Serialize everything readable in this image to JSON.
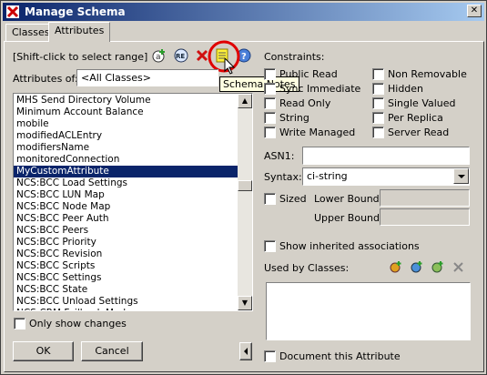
{
  "window": {
    "title": "Manage Schema",
    "close_glyph": "✕"
  },
  "tabs": [
    {
      "label": "Classes"
    },
    {
      "label": "Attributes"
    }
  ],
  "left": {
    "hint": "[Shift-click to select range]",
    "attributes_of_label": "Attributes of:",
    "attributes_of_value": "<All Classes>",
    "toolbar_icons": [
      "add-attribute-icon",
      "rename-icon",
      "delete-icon",
      "schema-notes-icon",
      "help-icon"
    ],
    "items": [
      "MHS Send Directory Volume",
      "Minimum Account Balance",
      "mobile",
      "modifiedACLEntry",
      "modifiersName",
      "monitoredConnection",
      "MyCustomAttribute",
      "NCS:BCC Load Settings",
      "NCS:BCC LUN Map",
      "NCS:BCC Node Map",
      "NCS:BCC Peer Auth",
      "NCS:BCC Peers",
      "NCS:BCC Priority",
      "NCS:BCC Revision",
      "NCS:BCC Scripts",
      "NCS:BCC Settings",
      "NCS:BCC State",
      "NCS:BCC Unload Settings",
      "NCS:CRM Failback Mode"
    ],
    "selected_index": 6,
    "only_show_changes": "Only show changes",
    "ok": "OK",
    "cancel": "Cancel"
  },
  "tooltip": "Schema Notes",
  "right": {
    "constraints_label": "Constraints:",
    "constraints_col1": [
      "Public Read",
      "Sync Immediate",
      "Read Only",
      "String",
      "Write Managed"
    ],
    "constraints_col2": [
      "Non Removable",
      "Hidden",
      "Single Valued",
      "Per Replica",
      "Server Read"
    ],
    "asn1_label": "ASN1:",
    "asn1_value": "",
    "syntax_label": "Syntax:",
    "syntax_value": "ci-string",
    "sized_label": "Sized",
    "lower_bound_label": "Lower Bound:",
    "upper_bound_label": "Upper Bound:",
    "show_inherited": "Show inherited associations",
    "used_by_label": "Used by Classes:",
    "used_by_icons": [
      "add-class-icon",
      "add-class-2-icon",
      "refresh-class-icon",
      "remove-class-icon"
    ],
    "document_attr": "Document this Attribute"
  },
  "colors": {
    "title_start": "#0a246a",
    "title_end": "#a6caf0",
    "selection": "#0a246a",
    "face": "#d4d0c8",
    "tooltip_bg": "#ffffe1",
    "highlight_ring": "#e00000"
  }
}
